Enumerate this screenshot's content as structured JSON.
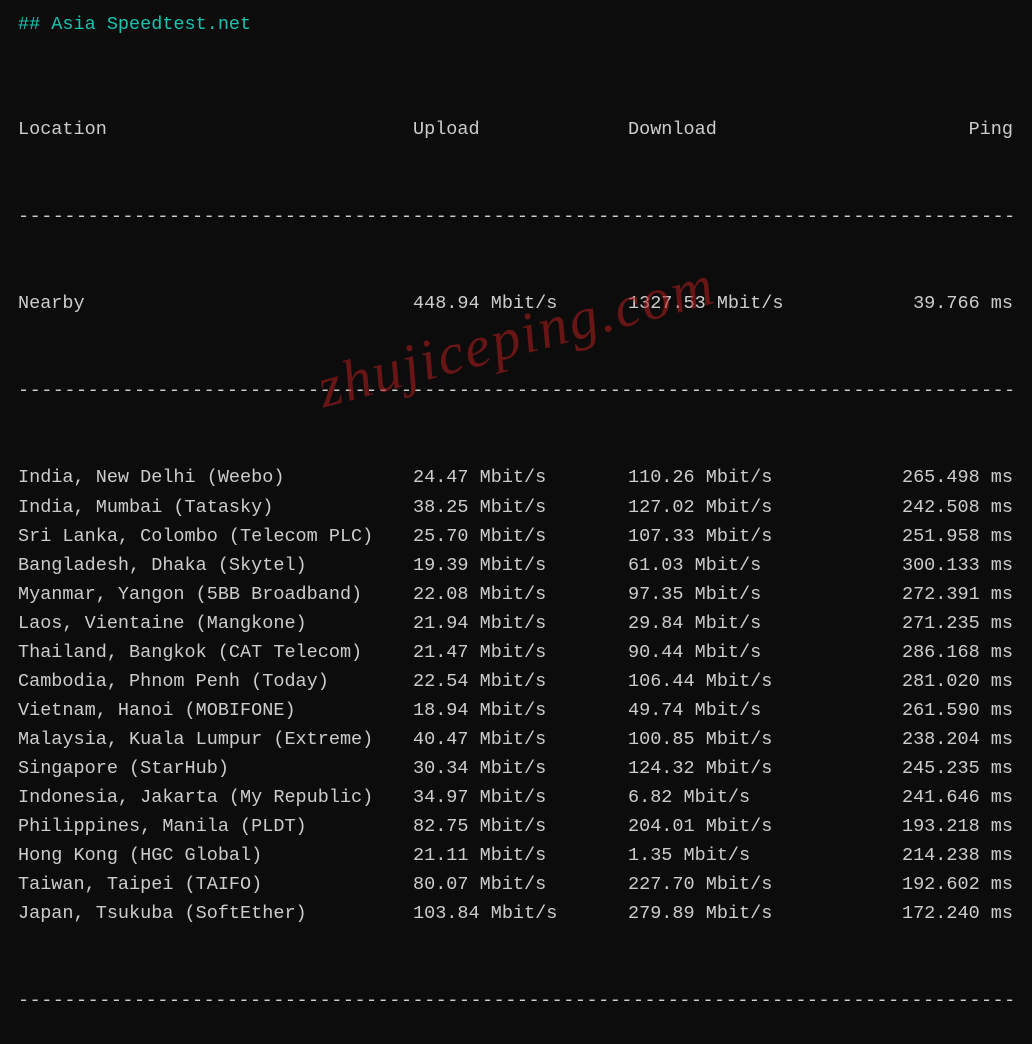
{
  "title": "## Asia Speedtest.net",
  "headers": {
    "location": "Location",
    "upload": "Upload",
    "download": "Download",
    "ping": "Ping"
  },
  "nearby": {
    "location": "Nearby",
    "upload": "448.94 Mbit/s",
    "download": "1327.53 Mbit/s",
    "ping": "39.766 ms"
  },
  "rows": [
    {
      "location": "India, New Delhi (Weebo)",
      "upload": "24.47 Mbit/s",
      "download": "110.26 Mbit/s",
      "ping": "265.498 ms"
    },
    {
      "location": "India, Mumbai (Tatasky)",
      "upload": "38.25 Mbit/s",
      "download": "127.02 Mbit/s",
      "ping": "242.508 ms"
    },
    {
      "location": "Sri Lanka, Colombo (Telecom PLC)",
      "upload": "25.70 Mbit/s",
      "download": "107.33 Mbit/s",
      "ping": "251.958 ms"
    },
    {
      "location": "Bangladesh, Dhaka (Skytel)",
      "upload": "19.39 Mbit/s",
      "download": "61.03 Mbit/s",
      "ping": "300.133 ms"
    },
    {
      "location": "Myanmar, Yangon (5BB Broadband)",
      "upload": "22.08 Mbit/s",
      "download": "97.35 Mbit/s",
      "ping": "272.391 ms"
    },
    {
      "location": "Laos, Vientaine (Mangkone)",
      "upload": "21.94 Mbit/s",
      "download": "29.84 Mbit/s",
      "ping": "271.235 ms"
    },
    {
      "location": "Thailand, Bangkok (CAT Telecom)",
      "upload": "21.47 Mbit/s",
      "download": "90.44 Mbit/s",
      "ping": "286.168 ms"
    },
    {
      "location": "Cambodia, Phnom Penh (Today)",
      "upload": "22.54 Mbit/s",
      "download": "106.44 Mbit/s",
      "ping": "281.020 ms"
    },
    {
      "location": "Vietnam, Hanoi (MOBIFONE)",
      "upload": "18.94 Mbit/s",
      "download": "49.74 Mbit/s",
      "ping": "261.590 ms"
    },
    {
      "location": "Malaysia, Kuala Lumpur (Extreme)",
      "upload": "40.47 Mbit/s",
      "download": "100.85 Mbit/s",
      "ping": "238.204 ms"
    },
    {
      "location": "Singapore (StarHub)",
      "upload": "30.34 Mbit/s",
      "download": "124.32 Mbit/s",
      "ping": "245.235 ms"
    },
    {
      "location": "Indonesia, Jakarta (My Republic)",
      "upload": "34.97 Mbit/s",
      "download": "6.82 Mbit/s",
      "ping": "241.646 ms"
    },
    {
      "location": "Philippines, Manila (PLDT)",
      "upload": "82.75 Mbit/s",
      "download": "204.01 Mbit/s",
      "ping": "193.218 ms"
    },
    {
      "location": "Hong Kong (HGC Global)",
      "upload": "21.11 Mbit/s",
      "download": "1.35 Mbit/s",
      "ping": "214.238 ms"
    },
    {
      "location": "Taiwan, Taipei (TAIFO)",
      "upload": "80.07 Mbit/s",
      "download": "227.70 Mbit/s",
      "ping": "192.602 ms"
    },
    {
      "location": "Japan, Tsukuba (SoftEther)",
      "upload": "103.84 Mbit/s",
      "download": "279.89 Mbit/s",
      "ping": "172.240 ms"
    }
  ],
  "watermark": "zhujiceping.com",
  "dashes": "------------------------------------------------------------------------------------------"
}
